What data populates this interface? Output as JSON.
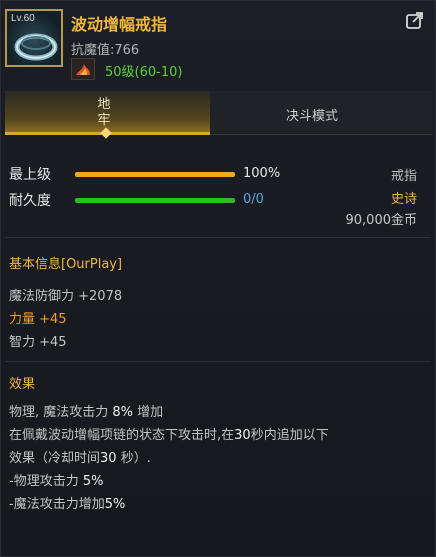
{
  "item": {
    "level_badge": "Lv.60",
    "name": "波动增幅戒指",
    "resistance": "抗魔值:766",
    "level_requirement": "50级(60-10)"
  },
  "tabs": [
    {
      "label": "地\n牢",
      "active": true
    },
    {
      "label": "决斗模式",
      "active": false
    }
  ],
  "stats": {
    "max_level": {
      "label": "最上级",
      "value": "100%",
      "fill": 1.0
    },
    "durability": {
      "label": "耐久度",
      "value": "0/0",
      "fill": 1.0
    }
  },
  "meta": {
    "type": "戒指",
    "rarity": "史诗",
    "price": "90,000金币"
  },
  "basic_info": {
    "title": "基本信息[OurPlay]",
    "lines": [
      {
        "text": "魔法防御力 +2078",
        "color": "gray"
      },
      {
        "text": "力量 +45",
        "color": "orange"
      },
      {
        "text": "智力 +45",
        "color": "gray"
      }
    ]
  },
  "effect": {
    "title": "效果",
    "line1_pre": "物理, 魔法攻击力 ",
    "line1_num": "8%",
    "line1_post": " 增加",
    "line2_pre": "在佩戴波动增幅项链的状态下攻击时,在",
    "line2_num": "30",
    "line2_post": "秒内追加以下",
    "line3_pre": "效果（冷却时间",
    "line3_num": "30",
    "line3_post": " 秒）.",
    "line4_pre": "-物理攻击力 ",
    "line4_num": "5%",
    "line5_pre": "-魔法攻击力增加",
    "line5_num": "5%"
  },
  "colors": {
    "gold": "#f0b73c",
    "green": "#5fd13a",
    "orange": "#f09b24"
  }
}
